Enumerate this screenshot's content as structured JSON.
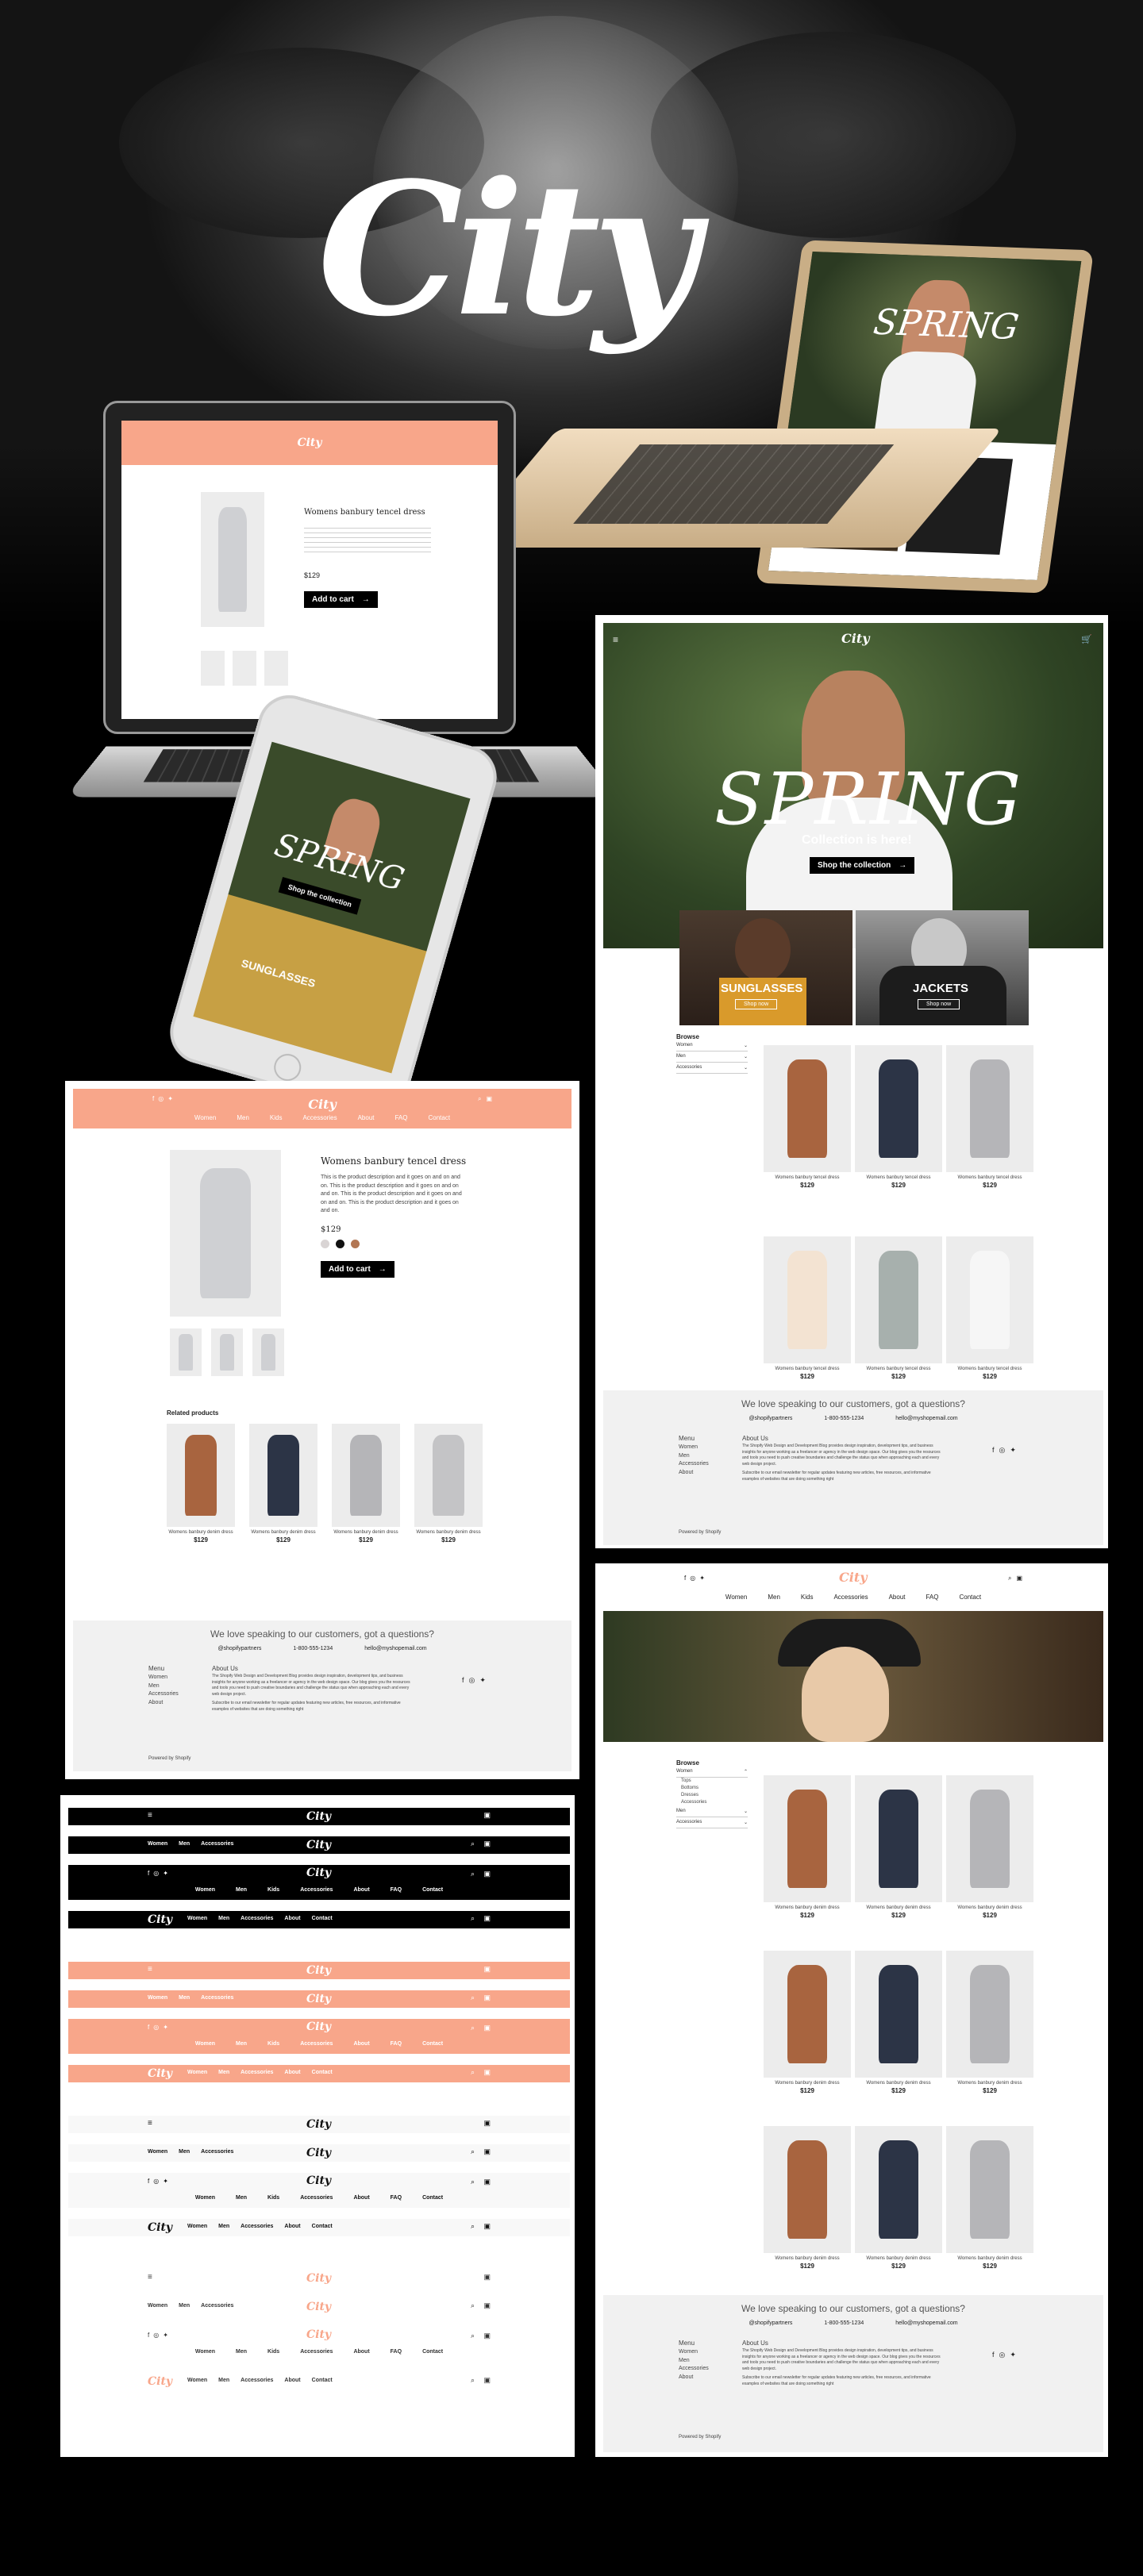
{
  "brand": {
    "logo_text": "City",
    "accent": "#f8a68a",
    "dark": "#000000",
    "light_gray": "#f1f1f1"
  },
  "laptop_site": {
    "product_title": "Womens banbury tencel dress",
    "price": "$129",
    "add_to_cart": "Add to cart"
  },
  "macbook_site": {
    "hero_word": "SPRING"
  },
  "phone_site": {
    "hero_word": "SPRING",
    "cta": "Shop the collection",
    "tile": "SUNGLASSES"
  },
  "home": {
    "hero_word": "SPRING",
    "hero_sub": "Collection is here!",
    "hero_cta": "Shop the collection",
    "tiles": [
      {
        "title": "SUNGLASSES",
        "cta": "Shop now"
      },
      {
        "title": "JACKETS",
        "cta": "Shop now"
      }
    ],
    "browse": {
      "title": "Browse",
      "options": [
        "Women",
        "Men",
        "Accessories"
      ]
    },
    "products": [
      {
        "name": "Womens banbury tencel dress",
        "price": "$129",
        "color": "#a8643f"
      },
      {
        "name": "Womens banbury tencel dress",
        "price": "$129",
        "color": "#2c3446"
      },
      {
        "name": "Womens banbury tencel dress",
        "price": "$129",
        "color": "#b5b5b8"
      },
      {
        "name": "Womens banbury tencel dress",
        "price": "$129",
        "color": "#f3e3d2"
      },
      {
        "name": "Womens banbury tencel dress",
        "price": "$129",
        "color": "#a7b0ad"
      },
      {
        "name": "Womens banbury tencel dress",
        "price": "$129",
        "color": "#f6f6f6"
      }
    ]
  },
  "product_page": {
    "nav": [
      "Women",
      "Men",
      "Kids",
      "Accessories",
      "About",
      "FAQ",
      "Contact"
    ],
    "title": "Womens banbury tencel dress",
    "description": "This is the product description and it goes on and on and on. This is the product description and it goes on and on and on. This is the product description and it goes on and on and on. This is the product description and it goes on and on.",
    "price": "$129",
    "swatches": [
      "#d9d4d4",
      "#111111",
      "#b27653"
    ],
    "add_to_cart": "Add to cart",
    "related_title": "Related products",
    "related": [
      {
        "name": "Womens banbury denim dress",
        "price": "$129",
        "color": "#a8643f"
      },
      {
        "name": "Womens banbury denim dress",
        "price": "$129",
        "color": "#2c3446"
      },
      {
        "name": "Womens banbury denim dress",
        "price": "$129",
        "color": "#b5b5b8"
      },
      {
        "name": "Womens banbury denim dress",
        "price": "$129",
        "color": "#c4c4c6"
      }
    ]
  },
  "footer": {
    "headline": "We love speaking to our customers, got a questions?",
    "contacts": [
      "@shopifypartners",
      "1-800-555-1234",
      "hello@myshopemail.com"
    ],
    "menu_title": "Menu",
    "menu": [
      "Women",
      "Men",
      "Accessories",
      "About"
    ],
    "about_title": "About Us",
    "about_text": "The Shopify Web Design and Development Blog provides design inspiration, development tips, and business insights for anyone working as a freelancer or agency in the web design space. Our blog gives you the resources and tools you need to push creative boundaries and challenge the status quo when approaching each and every web design project.",
    "subscribe_text": "Subscribe to our email newsletter for regular updates featuring new articles, free resources, and informative examples of websites that are doing something right",
    "powered": "Powered by Shopify"
  },
  "collection_page": {
    "nav": [
      "Women",
      "Men",
      "Kids",
      "Accessories",
      "About",
      "FAQ",
      "Contact"
    ],
    "browse_title": "Browse",
    "filters": [
      "Women",
      "Tops",
      "Bottoms",
      "Dresses",
      "Accessories",
      "Men",
      "Accessories"
    ],
    "product_name": "Womens banbury denim dress",
    "price": "$129",
    "colors": [
      "#a8643f",
      "#2c3446",
      "#b5b5b8",
      "#a8643f",
      "#2c3446",
      "#b5b5b8",
      "#a8643f",
      "#2c3446",
      "#b5b5b8"
    ]
  },
  "header_variants": {
    "nav_short": [
      "Women",
      "Men",
      "Accessories"
    ],
    "nav_long": [
      "Women",
      "Men",
      "Kids",
      "Accessories",
      "About",
      "FAQ",
      "Contact"
    ],
    "nav_mid": [
      "Women",
      "Men",
      "Accessories",
      "About",
      "Contact"
    ]
  }
}
